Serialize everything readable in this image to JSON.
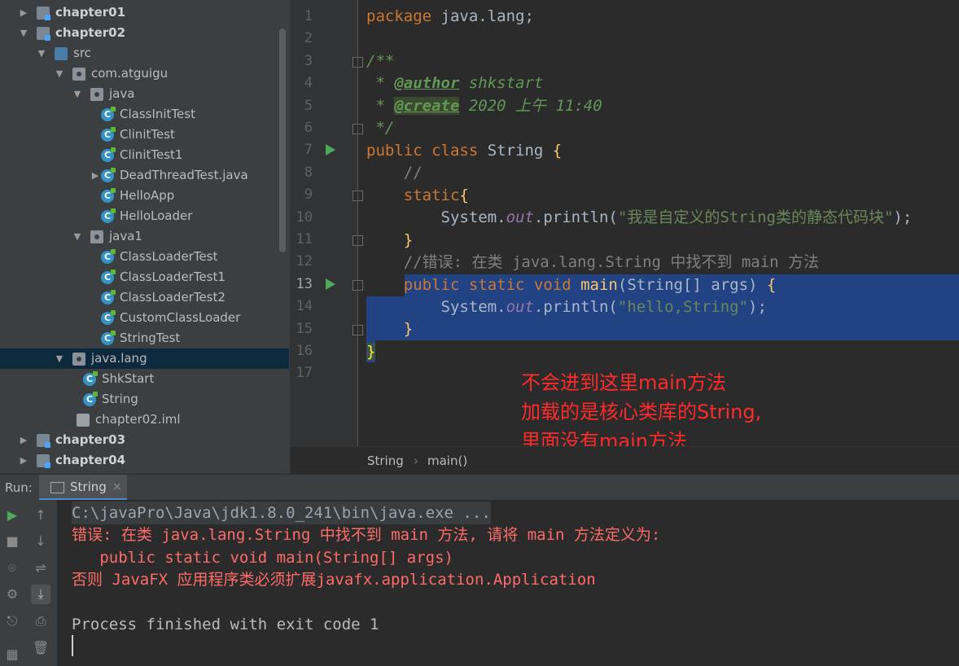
{
  "project_tree": {
    "items": [
      {
        "label": "chapter01",
        "icon": "module-folder-icon",
        "arrow": "▶",
        "bold": true
      },
      {
        "label": "chapter02",
        "icon": "module-folder-icon",
        "arrow": "▼",
        "bold": true
      },
      {
        "label": "src",
        "icon": "source-folder-icon",
        "arrow": "▼"
      },
      {
        "label": "com.atguigu",
        "icon": "package-icon",
        "arrow": "▼"
      },
      {
        "label": "java",
        "icon": "package-icon",
        "arrow": "▼"
      },
      {
        "label": "ClassInitTest",
        "icon": "class-icon"
      },
      {
        "label": "ClinitTest",
        "icon": "class-icon"
      },
      {
        "label": "ClinitTest1",
        "icon": "class-icon"
      },
      {
        "label": "DeadThreadTest.java",
        "icon": "class-icon",
        "arrow": "▶"
      },
      {
        "label": "HelloApp",
        "icon": "class-icon"
      },
      {
        "label": "HelloLoader",
        "icon": "class-icon"
      },
      {
        "label": "java1",
        "icon": "package-icon",
        "arrow": "▼"
      },
      {
        "label": "ClassLoaderTest",
        "icon": "class-icon"
      },
      {
        "label": "ClassLoaderTest1",
        "icon": "class-icon"
      },
      {
        "label": "ClassLoaderTest2",
        "icon": "class-icon"
      },
      {
        "label": "CustomClassLoader",
        "icon": "class-icon"
      },
      {
        "label": "StringTest",
        "icon": "class-icon"
      },
      {
        "label": "java.lang",
        "icon": "package-icon",
        "arrow": "▼",
        "selected": true
      },
      {
        "label": "ShkStart",
        "icon": "class-icon"
      },
      {
        "label": "String",
        "icon": "class-icon"
      },
      {
        "label": "chapter02.iml",
        "icon": "iml-file-icon"
      },
      {
        "label": "chapter03",
        "icon": "module-folder-icon",
        "arrow": "▶",
        "bold": true
      },
      {
        "label": "chapter04",
        "icon": "module-folder-icon",
        "arrow": "▶",
        "bold": true
      }
    ]
  },
  "editor": {
    "line_numbers": [
      "1",
      "2",
      "3",
      "4",
      "5",
      "6",
      "7",
      "8",
      "9",
      "10",
      "11",
      "12",
      "13",
      "14",
      "15",
      "16",
      "17"
    ],
    "current_line": "13",
    "code": {
      "l1_kw": "package",
      "l1_rest": " java.lang;",
      "l3": "/**",
      "l4_star": " * ",
      "l4_tag": "@author",
      "l4_val": " shkstart",
      "l5_star": " * ",
      "l5_tag": "@create",
      "l5_val": " 2020 上午 11:40",
      "l6": " */",
      "l7_kw": "public class",
      "l7_rest": " String ",
      "l7_brace": "{",
      "l8": "    //",
      "l9_kw": "    static",
      "l9_brace": "{",
      "l10_a": "        System.",
      "l10_field": "out",
      "l10_b": ".println(",
      "l10_str": "\"我是自定义的String类的静态代码块\"",
      "l10_c": ");",
      "l11": "    }",
      "l12": "    //错误: 在类 java.lang.String 中找不到 main 方法",
      "l13_kw": "    public static void",
      "l13_method": " main",
      "l13_rest": "(String[] args) ",
      "l13_brace": "{",
      "l14_a": "        System.",
      "l14_field": "out",
      "l14_b": ".println(",
      "l14_str": "\"hello,String\"",
      "l14_c": ");",
      "l15": "    }",
      "l16": "}"
    },
    "breadcrumb": [
      "String",
      "main()"
    ],
    "breadcrumb_sep": "›",
    "annotation": "不会进到这里main方法\n加载的是核心类库的String,\n里面没有main方法\n所以报错",
    "annotation_color": "#ff2a2a"
  },
  "run_panel": {
    "label": "Run:",
    "tab_label": "String",
    "tab_close": "×",
    "console_lines": [
      "C:\\javaPro\\Java\\jdk1.8.0_241\\bin\\java.exe ...",
      "错误: 在类 java.lang.String 中找不到 main 方法, 请将 main 方法定义为:",
      "   public static void main(String[] args)",
      "否则 JavaFX 应用程序类必须扩展javafx.application.Application",
      "Process finished with exit code 1"
    ],
    "tools": [
      "▶",
      "↑",
      "■",
      "↓",
      "⌾",
      "⇌",
      "⚙",
      "⤓",
      "⎋",
      "⎙",
      "▦",
      "🗑"
    ]
  },
  "colors": {
    "keyword": "#cc7832",
    "string": "#6a8759",
    "error_text": "#ff6b68",
    "selection": "#214283",
    "tree_selection": "#0d293e"
  }
}
